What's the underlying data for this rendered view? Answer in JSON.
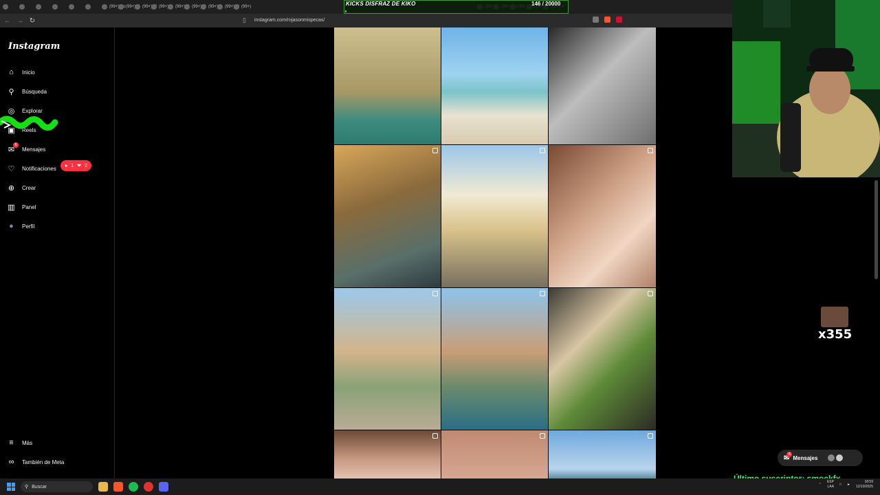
{
  "browser": {
    "tabs": [
      {
        "label": ""
      },
      {
        "label": ""
      },
      {
        "label": ""
      },
      {
        "label": ""
      },
      {
        "label": ""
      },
      {
        "label": ""
      },
      {
        "label": "(99+) Co"
      },
      {
        "label": "(99+) #l"
      },
      {
        "label": "(99+) #f"
      },
      {
        "label": "(99+) B"
      },
      {
        "label": "(99+) #l"
      },
      {
        "label": "(99+) #l"
      },
      {
        "label": "(99+) #"
      },
      {
        "label": "(99+) Si"
      },
      {
        "label": "(99+)"
      }
    ],
    "tabs_right": [
      {
        "label": "(99+) ta"
      },
      {
        "label": "(99+) Ed"
      },
      {
        "label": "(99+) #e"
      },
      {
        "label": "(99+) #l"
      },
      {
        "label": "(99+) #"
      }
    ],
    "url": "instagram.com/rojasonmispecas/"
  },
  "overlay": {
    "goal_title": "KICKS DISFRAZ DE KIKO",
    "goal_count": "146 / 20000",
    "goal_progress": 0.0073
  },
  "sidebar": {
    "logo": "Instagram",
    "items": [
      {
        "label": "Inicio",
        "icon": "home-icon"
      },
      {
        "label": "Búsqueda",
        "icon": "search-icon"
      },
      {
        "label": "Explorar",
        "icon": "compass-icon"
      },
      {
        "label": "Reels",
        "icon": "reels-icon"
      },
      {
        "label": "Mensajes",
        "icon": "messenger-icon",
        "badge": "6"
      },
      {
        "label": "Notificaciones",
        "icon": "heart-icon"
      },
      {
        "label": "Crear",
        "icon": "plus-icon"
      },
      {
        "label": "Panel",
        "icon": "chart-icon"
      },
      {
        "label": "Perfil",
        "icon": "avatar-icon"
      }
    ],
    "notif_pill": {
      "comments": "1",
      "likes": "2"
    },
    "bottom_items": [
      {
        "label": "Más",
        "icon": "menu-icon"
      },
      {
        "label": "También de Meta",
        "icon": "meta-icon"
      }
    ]
  },
  "grid": {
    "tiles": [
      {
        "kind": "sea cave",
        "media": false
      },
      {
        "kind": "beach",
        "media": false
      },
      {
        "kind": "portrait bw",
        "media": false
      },
      {
        "kind": "boat cave",
        "media": true
      },
      {
        "kind": "street",
        "media": true
      },
      {
        "kind": "selfie",
        "media": true
      },
      {
        "kind": "giralda",
        "media": true
      },
      {
        "kind": "plaza",
        "media": true
      },
      {
        "kind": "food",
        "media": true
      },
      {
        "kind": "face",
        "media": true
      },
      {
        "kind": "skin",
        "media": true
      },
      {
        "kind": "sea",
        "media": true
      }
    ]
  },
  "stream": {
    "emote_combo": "x355",
    "messages_label": "Mensajes",
    "messages_badge": "6",
    "last_subscriber": "Último suscriptor: smockfx"
  },
  "taskbar": {
    "search_placeholder": "Buscar",
    "lang": "ESP",
    "lang2": "LAA",
    "time": "18:59",
    "date": "12/10/2025"
  },
  "colors": {
    "accent_red": "#ff3040",
    "sub_green": "#3df25a",
    "goal_green": "#2ecc40"
  }
}
